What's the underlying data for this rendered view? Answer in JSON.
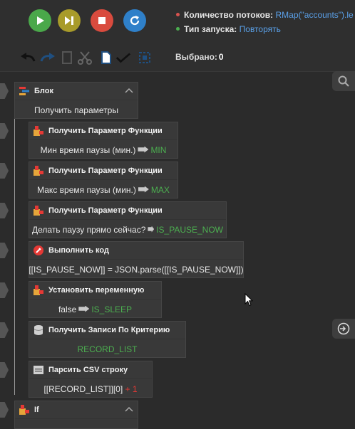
{
  "toolbar": {
    "run_buttons": [
      {
        "name": "play-icon",
        "color": "#4aa84a"
      },
      {
        "name": "next-step-icon",
        "color": "#a89b2a"
      },
      {
        "name": "stop-icon",
        "color": "#d94b3e"
      },
      {
        "name": "refresh-icon",
        "color": "#2f80c9"
      }
    ],
    "threads_label": "Количество потоков:",
    "threads_value": "RMap(\"accounts\").le",
    "launch_label": "Тип запуска:",
    "launch_value": "Повторять",
    "edit_tools": [
      "undo-icon",
      "redo-icon",
      "copy-icon",
      "cut-icon",
      "paste-icon",
      "select-all-icon",
      "deselect-icon"
    ],
    "selected_label": "Выбрано:",
    "selected_count": "0"
  },
  "blocks": [
    {
      "title": "Блок",
      "icon": "block-icon",
      "body": "Получить параметры",
      "collapsible": true
    },
    {
      "title": "Получить Параметр Функции",
      "icon": "puzzle-icon",
      "body_text": "Мин время паузы (мин.)",
      "body_var": "MIN"
    },
    {
      "title": "Получить Параметр Функции",
      "icon": "puzzle-icon",
      "body_text": "Макс время паузы (мин.)",
      "body_var": "MAX"
    },
    {
      "title": "Получить Параметр Функции",
      "icon": "puzzle-icon",
      "body_text": "Делать паузу прямо сейчас?",
      "body_var": "IS_PAUSE_NOW"
    },
    {
      "title": "Выполнить код",
      "icon": "code-icon",
      "body": "[[IS_PAUSE_NOW]] = JSON.parse([[IS_PAUSE_NOW]])"
    },
    {
      "title": "Установить переменную",
      "icon": "puzzle-icon",
      "body_text": "false",
      "body_var": "IS_SLEEP"
    },
    {
      "title": "Получить Записи По Критерию",
      "icon": "database-icon",
      "body_green": "RECORD_LIST"
    },
    {
      "title": "Парсить CSV строку",
      "icon": "csv-icon",
      "body_text": "[[RECORD_LIST]][0]",
      "body_red": "+ 1"
    },
    {
      "title": "If",
      "icon": "puzzle-icon",
      "collapsible": true
    }
  ]
}
